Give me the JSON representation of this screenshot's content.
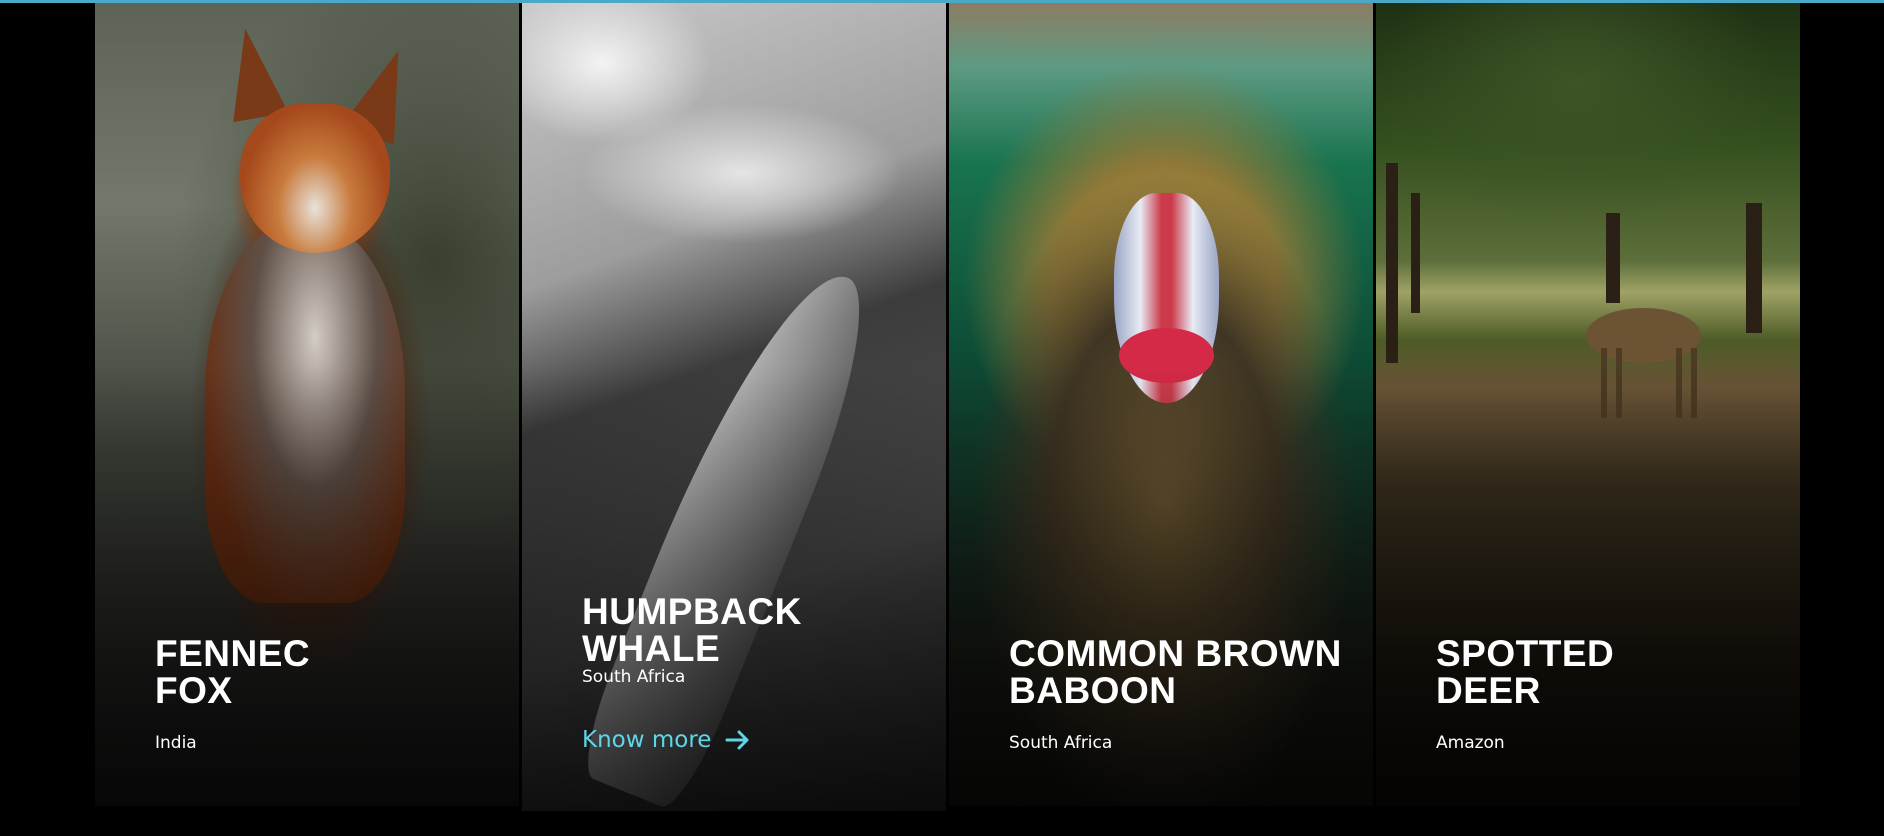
{
  "accent_color": "#5fd6e8",
  "top_line_color": "#4aa8c9",
  "cards": [
    {
      "title_line1": "FENNEC",
      "title_line2": "FOX",
      "location": "India"
    },
    {
      "title_line1": "HUMPBACK",
      "title_line2": "WHALE",
      "location": "South Africa",
      "cta": "Know more",
      "cta_icon": "arrow-right-icon"
    },
    {
      "title_line1": "COMMON BROWN",
      "title_line2": "BABOON",
      "location": "South Africa"
    },
    {
      "title_line1": "SPOTTED",
      "title_line2": "DEER",
      "location": "Amazon"
    }
  ]
}
